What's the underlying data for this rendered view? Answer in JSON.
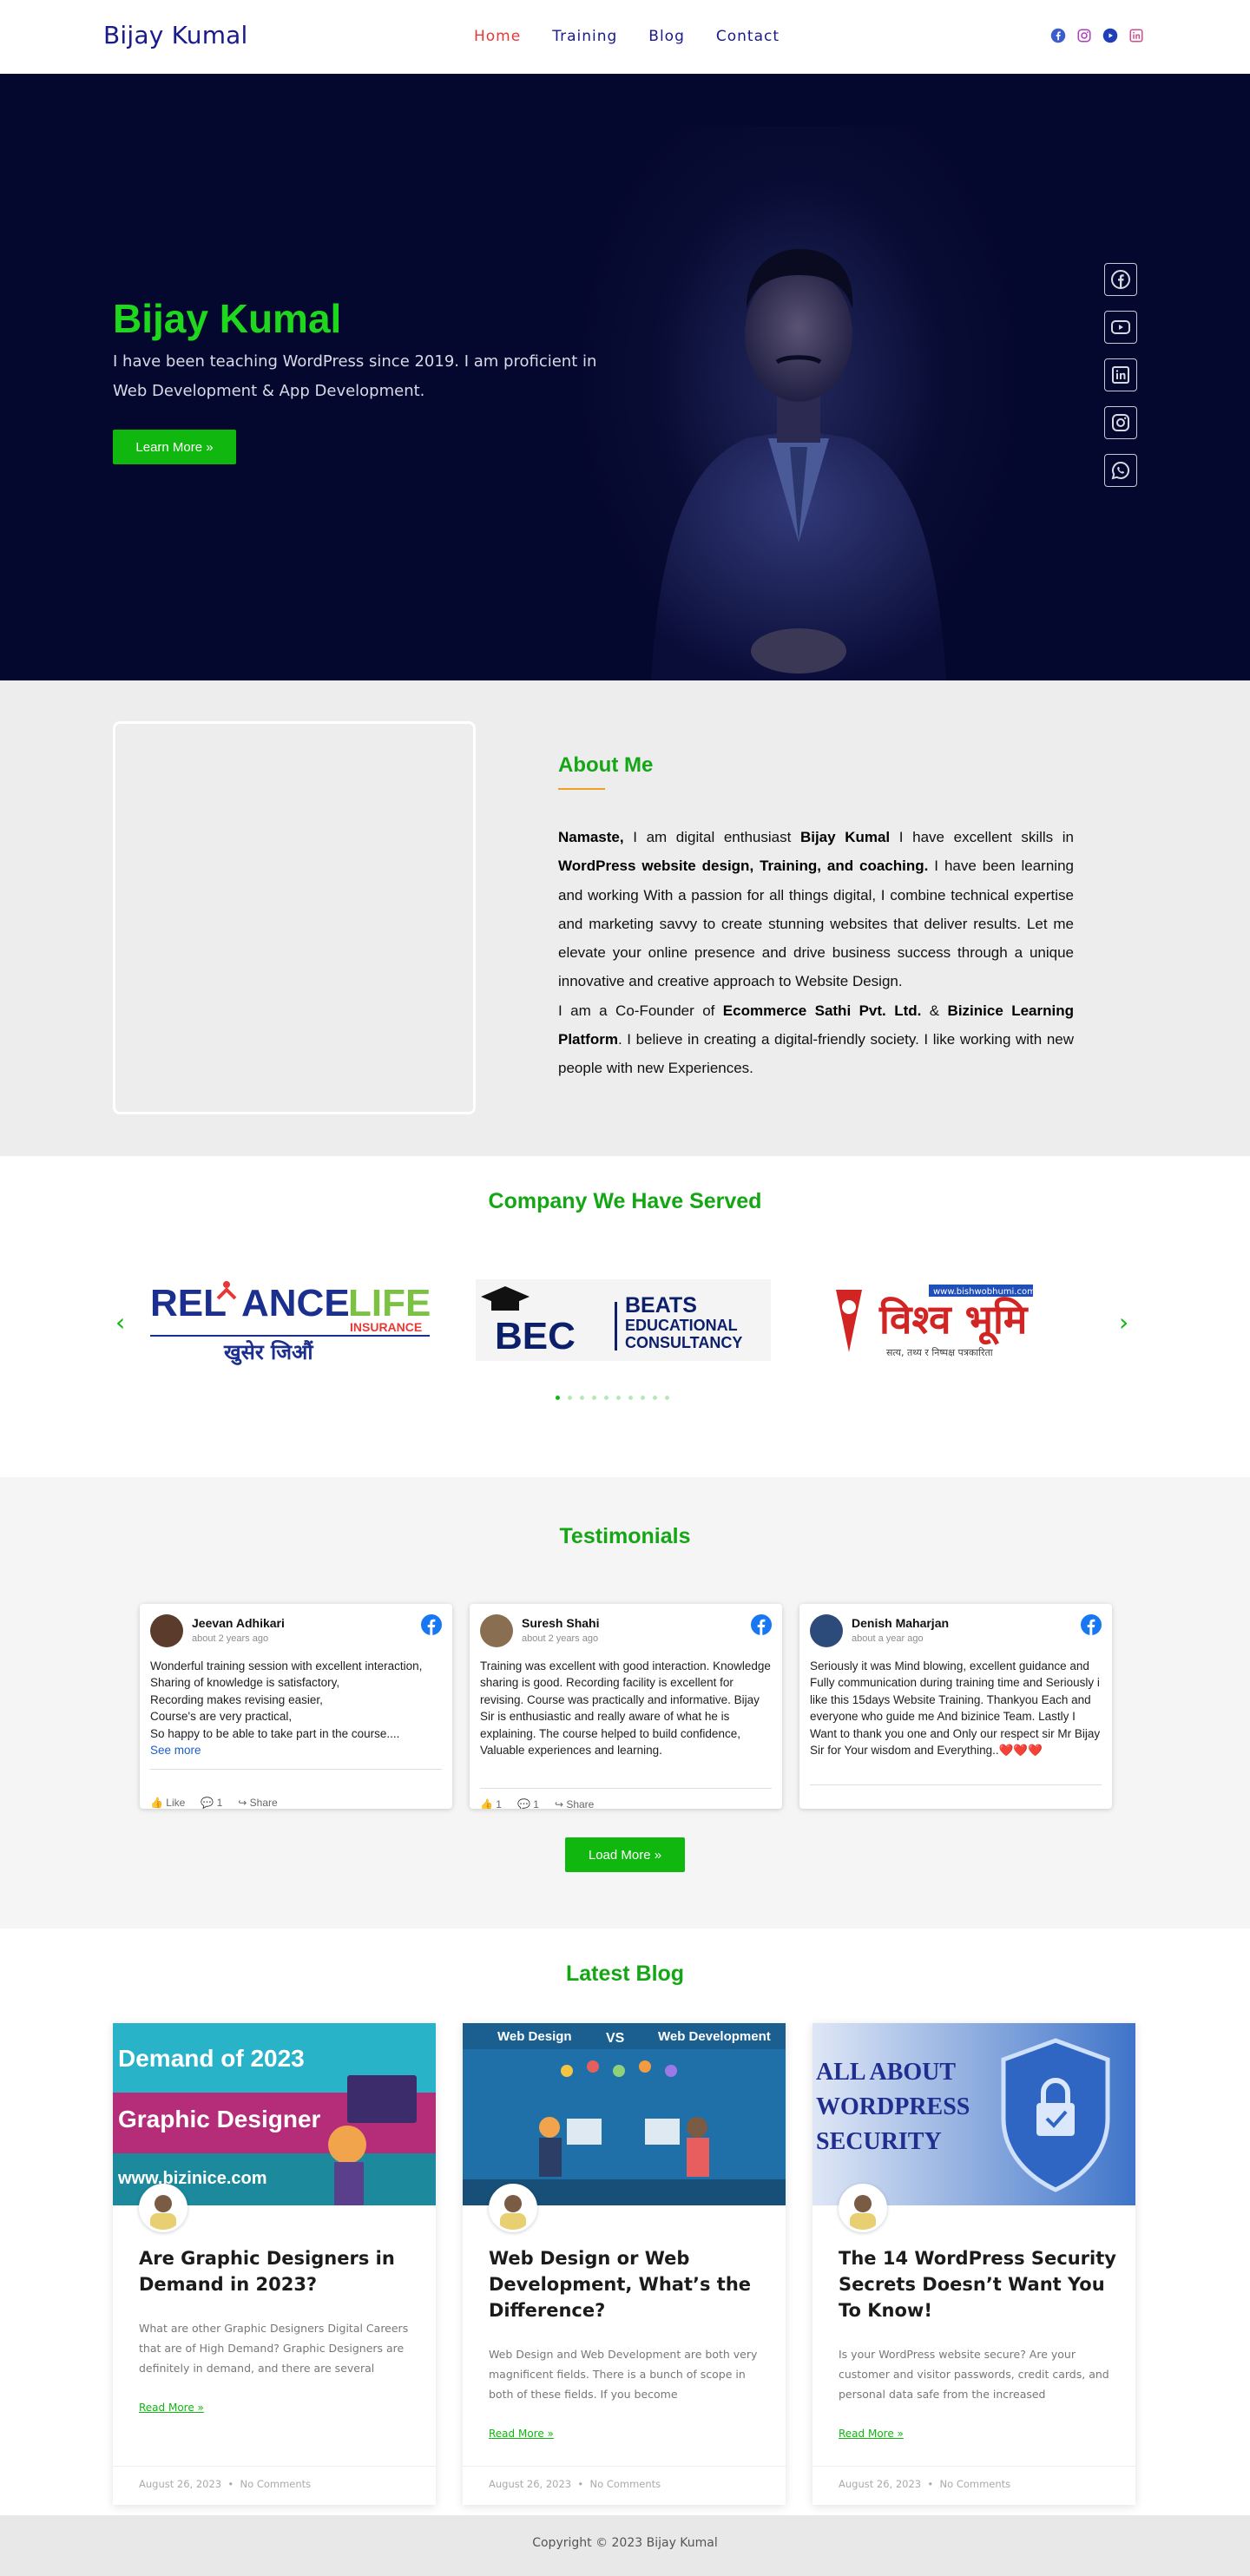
{
  "header": {
    "brand": "Bijay Kumal",
    "nav": [
      {
        "label": "Home",
        "active": true
      },
      {
        "label": "Training"
      },
      {
        "label": "Blog"
      },
      {
        "label": "Contact"
      }
    ],
    "social_icons": [
      "facebook-icon",
      "instagram-icon",
      "youtube-icon",
      "linkedin-icon"
    ]
  },
  "hero": {
    "title": "Bijay Kumal",
    "text": "I have been teaching WordPress since 2019. I am proficient in Web Development & App Development.",
    "button": "Learn More »",
    "side_icons": [
      "facebook-icon",
      "youtube-icon",
      "linkedin-icon",
      "instagram-icon",
      "whatsapp-icon"
    ]
  },
  "about": {
    "title": "About Me",
    "p1_intro": "Namaste,",
    "p1_a": " I am digital enthusiast ",
    "p1_name": "Bijay Kumal",
    "p1_b": " I have excellent skills in ",
    "p1_skills": "WordPress website design, Training, and coaching.",
    "p1_c": " I have been learning and working With a passion for all things digital, I combine technical expertise and marketing savvy to create stunning websites that deliver results. Let me elevate your online presence and drive business success through a unique innovative and creative approach to Website Design.",
    "p2_a": "I am a Co-Founder of  ",
    "p2_company1": "Ecommerce Sathi Pvt. Ltd.",
    "p2_amp": " & ",
    "p2_company2": "Bizinice Learning Platform",
    "p2_b": ". I believe in creating a digital-friendly society. I like working with new people with new Experiences."
  },
  "companies": {
    "title": "Company We Have Served",
    "logos": [
      {
        "line1a": "REL",
        "line1b": "ANCE",
        "line1c": "LIFE",
        "line2": "INSURANCE",
        "line3": "खुसेर जिऔं"
      },
      {
        "mark": "BEC",
        "line1": "BEATS",
        "line2": "EDUCATIONAL",
        "line3": "CONSULTANCY"
      },
      {
        "url": "www.bishwobhumi.com",
        "title": "विश्व भूमि",
        "tagline": "सत्य, तथ्य र निष्पक्ष पत्रकारिता"
      }
    ],
    "prev": "‹",
    "next": "›",
    "dots": 10,
    "active_dot": 0
  },
  "testimonials": {
    "title": "Testimonials",
    "cards": [
      {
        "name": "Jeevan Adhikari",
        "time": "about 2 years ago",
        "text": "Wonderful training session with excellent interaction,\nSharing of knowledge is satisfactory,\nRecording makes revising easier,\nCourse's are very practical,\nSo happy to be able to take part in the course....",
        "more": "See more",
        "likes": "Like",
        "comments": "1",
        "share": "Share"
      },
      {
        "name": "Suresh Shahi",
        "time": "about 2 years ago",
        "text": "Training was excellent with good interaction. Knowledge sharing is good. Recording facility is excellent for revising. Course was practically and informative. Bijay Sir is enthusiastic and really aware of what he is explaining. The course helped to build confidence, Valuable experiences and learning.",
        "likes": "1",
        "comments": "1",
        "share": "Share"
      },
      {
        "name": "Denish Maharjan",
        "time": "about a year ago",
        "text": "Seriously it was Mind blowing, excellent guidance and Fully communication during training time and Seriously i like this 15days Website Training. Thankyou Each and everyone who guide me And bizinice Team. Lastly I Want to thank you one and Only our respect sir Mr Bijay Sir for Your wisdom and Everything..❤️❤️❤️"
      }
    ],
    "button": "Load More »"
  },
  "blog": {
    "title": "Latest Blog",
    "posts": [
      {
        "image_text": [
          "Demand of 2023",
          "Graphic Designer",
          "www.bizinice.com"
        ],
        "title": "Are Graphic Designers in Demand in 2023?",
        "excerpt": "What are other Graphic Designers Digital Careers that are of High Demand? Graphic Designers are definitely in demand, and there are several",
        "read_more": "Read More »",
        "date": "August 26, 2023",
        "comments": "No Comments"
      },
      {
        "image_text": [
          "Web Design",
          "VS",
          "Web Development"
        ],
        "title": "Web Design or Web Development, What’s the Difference?",
        "excerpt": "Web Design and Web Development are both very magnificent fields. There is a bunch of scope in both of these fields. If you become",
        "read_more": "Read More »",
        "date": "August 26, 2023",
        "comments": "No Comments"
      },
      {
        "image_text": [
          "ALL ABOUT",
          "WORDPRESS",
          "SECURITY"
        ],
        "title": "The 14 WordPress Security Secrets Doesn’t Want You To Know!",
        "excerpt": "Is your WordPress website secure? Are your customer and visitor passwords, credit cards, and personal data safe from the increased",
        "read_more": "Read More »",
        "date": "August 26, 2023",
        "comments": "No Comments"
      }
    ]
  },
  "footer": {
    "copyright": "Copyright © 2023 Bijay Kumal"
  },
  "colors": {
    "brand_navy": "#1a1a8c",
    "accent_green": "#0fb70f",
    "hero_bg": "#05082e",
    "nav_active": "#e53935"
  }
}
